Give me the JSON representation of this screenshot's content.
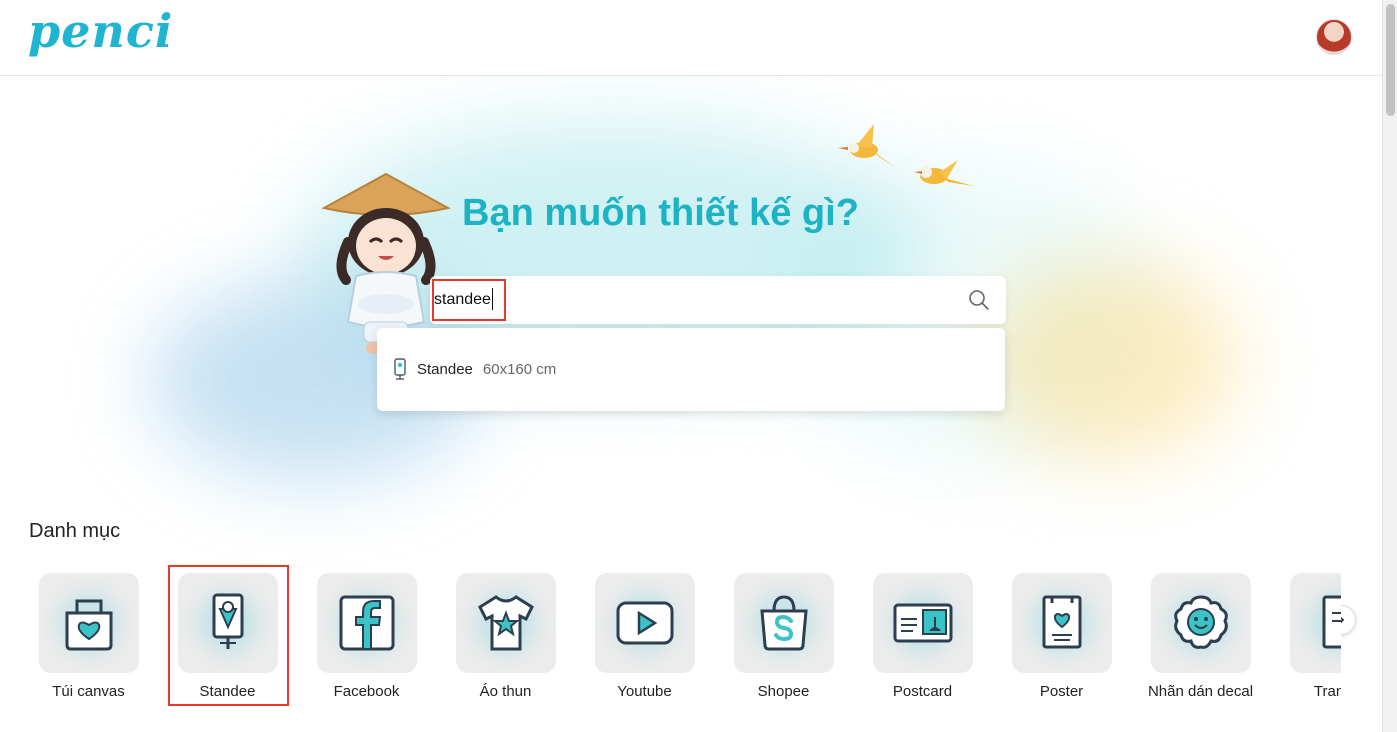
{
  "header": {
    "logo_text": "penci",
    "avatar_alt": "avatar"
  },
  "hero": {
    "title": "Bạn muốn thiết kế gì?"
  },
  "search": {
    "value": "standee",
    "suggestions": [
      {
        "name": "Standee",
        "size": "60x160 cm",
        "icon": "standee-icon"
      }
    ]
  },
  "categories": {
    "title": "Danh mục",
    "selected": "Standee",
    "items": [
      {
        "label": "Túi canvas",
        "icon": "tote-bag-icon"
      },
      {
        "label": "Standee",
        "icon": "standee-icon"
      },
      {
        "label": "Facebook",
        "icon": "facebook-icon"
      },
      {
        "label": "Áo thun",
        "icon": "tshirt-icon"
      },
      {
        "label": "Youtube",
        "icon": "youtube-icon"
      },
      {
        "label": "Shopee",
        "icon": "shopee-icon"
      },
      {
        "label": "Postcard",
        "icon": "postcard-icon"
      },
      {
        "label": "Poster",
        "icon": "poster-icon"
      },
      {
        "label": "Nhãn dán decal",
        "icon": "sticker-icon"
      },
      {
        "label": "Tranh đ",
        "icon": "painting-icon"
      }
    ]
  },
  "colors": {
    "brand": "#1fb4d0",
    "title": "#1cb3c4",
    "highlight": "#e53a2a",
    "icon_stroke": "#2c3e50",
    "icon_fill": "#3cc3c6"
  }
}
